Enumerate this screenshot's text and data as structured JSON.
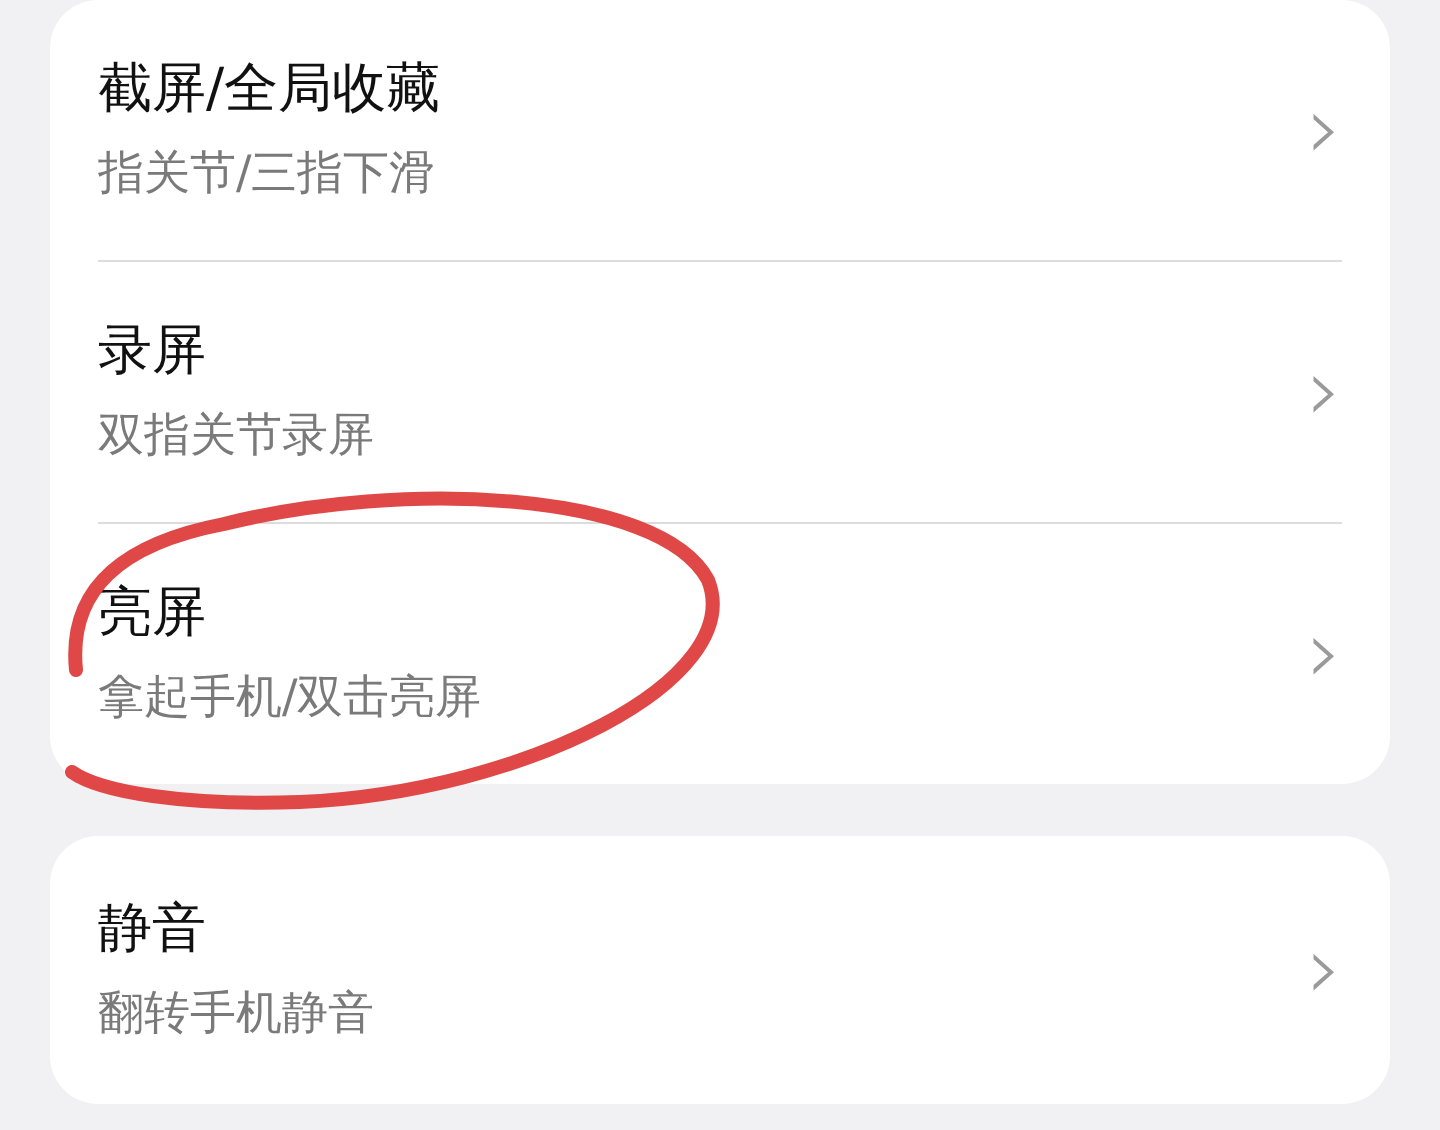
{
  "groups": [
    {
      "items": [
        {
          "title": "截屏/全局收藏",
          "subtitle": "指关节/三指下滑",
          "chevron": "›"
        },
        {
          "title": "录屏",
          "subtitle": "双指关节录屏",
          "chevron": "›"
        },
        {
          "title": "亮屏",
          "subtitle": "拿起手机/双击亮屏",
          "chevron": "›"
        }
      ]
    },
    {
      "items": [
        {
          "title": "静音",
          "subtitle": "翻转手机静音",
          "chevron": "›"
        }
      ]
    }
  ]
}
